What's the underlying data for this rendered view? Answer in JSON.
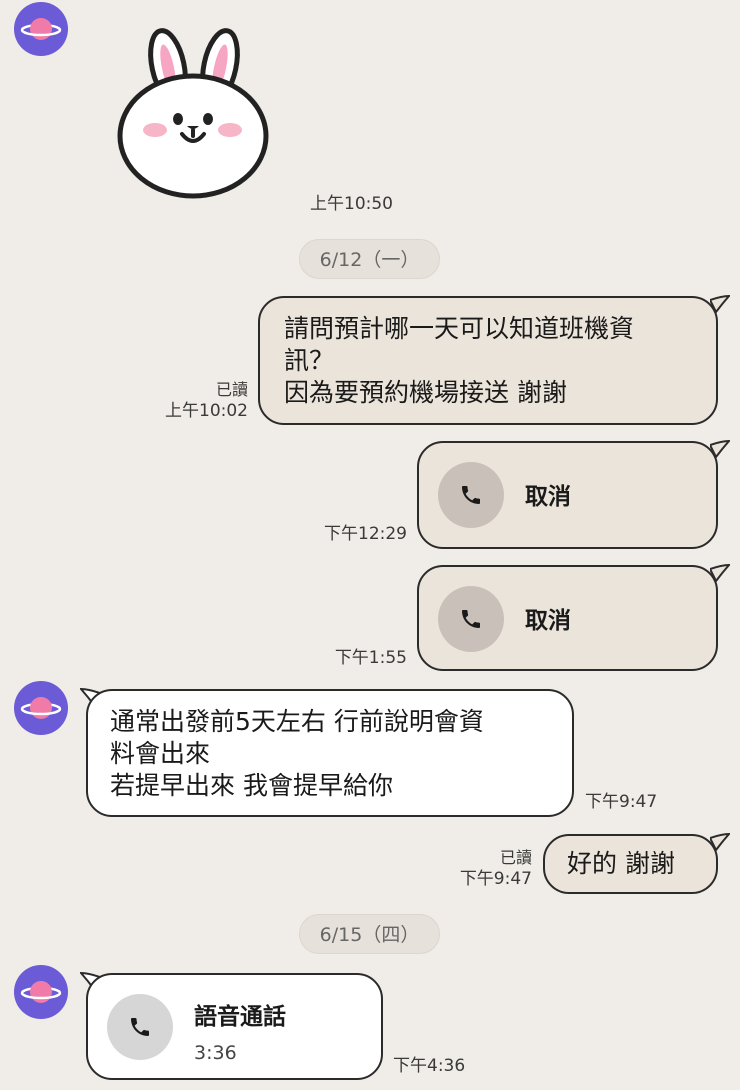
{
  "sticker": {
    "name": "bunny-sticker",
    "time": "上午10:50"
  },
  "dates": [
    "6/12（一）",
    "6/15（四）"
  ],
  "messages": [
    {
      "side": "out",
      "lines": [
        "請問預計哪一天可以知道班機資",
        "訊？",
        "因為要預約機場接送 謝謝"
      ],
      "read": "已讀",
      "time": "上午10:02"
    },
    {
      "side": "out",
      "type": "call",
      "label": "取消",
      "time": "下午12:29"
    },
    {
      "side": "out",
      "type": "call",
      "label": "取消",
      "time": "下午1:55"
    },
    {
      "side": "in",
      "lines": [
        "通常出發前5天左右 行前說明會資",
        "料會出來",
        "若提早出來 我會提早給你"
      ],
      "time": "下午9:47"
    },
    {
      "side": "out",
      "lines": [
        "好的 謝謝"
      ],
      "read": "已讀",
      "time": "下午9:47"
    },
    {
      "side": "in",
      "type": "call",
      "label": "語音通話",
      "duration": "3:36",
      "time": "下午4:36"
    }
  ],
  "icons": {
    "avatar": "planet-avatar",
    "call": "phone-icon"
  },
  "colors": {
    "background": "#f0ece7",
    "outgoing_bubble": "#ebe4da",
    "incoming_bubble": "#ffffff",
    "avatar": "#6b5bd6"
  }
}
